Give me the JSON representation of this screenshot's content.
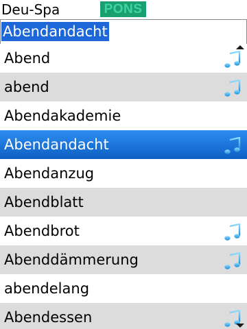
{
  "header": {
    "language_pair": "Deu-Spa",
    "logo_text": "PONS"
  },
  "search": {
    "value": "Abendandacht"
  },
  "list": {
    "items": [
      {
        "word": "Abend",
        "has_audio": true,
        "selected": false
      },
      {
        "word": "abend",
        "has_audio": true,
        "selected": false
      },
      {
        "word": "Abendakademie",
        "has_audio": false,
        "selected": false
      },
      {
        "word": "Abendandacht",
        "has_audio": true,
        "selected": true
      },
      {
        "word": "Abendanzug",
        "has_audio": false,
        "selected": false
      },
      {
        "word": "Abendblatt",
        "has_audio": false,
        "selected": false
      },
      {
        "word": "Abendbrot",
        "has_audio": true,
        "selected": false
      },
      {
        "word": "Abenddämmerung",
        "has_audio": true,
        "selected": false
      },
      {
        "word": "abendelang",
        "has_audio": false,
        "selected": false
      },
      {
        "word": "Abendessen",
        "has_audio": true,
        "selected": false
      }
    ]
  },
  "icons": {
    "audio": "music-note-icon",
    "scroll_up": "scroll-up-arrow-icon",
    "scroll_down": "scroll-down-arrow-icon"
  },
  "colors": {
    "selection_blue": "#1d67d8",
    "row_alt_gray": "#dcdcdc",
    "note_blue": "#3aa7ea",
    "logo_green": "#1a9f6e"
  }
}
